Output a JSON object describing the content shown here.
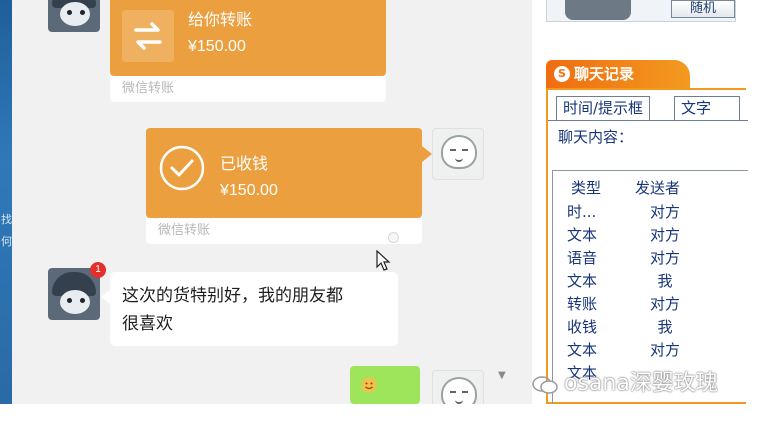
{
  "left_strip": {
    "glyphs": [
      "找",
      "何"
    ]
  },
  "chat": {
    "messages": [
      {
        "type": "transfer",
        "title": "给你转账",
        "amount": "¥150.00",
        "footer": "微信转账"
      },
      {
        "type": "received",
        "title": "已收钱",
        "amount": "¥150.00",
        "footer": "微信转账"
      },
      {
        "type": "text",
        "text_line1": "这次的货特别好，我的朋友都",
        "text_line2": "很喜欢"
      }
    ],
    "unread_badge": "1"
  },
  "right_panel": {
    "random_button": "随机",
    "history_title": "聊天记录",
    "tabs": [
      "时间/提示框",
      "文字"
    ],
    "content_label": "聊天内容：",
    "columns": [
      "类型",
      "发送者"
    ],
    "rows": [
      {
        "type": "时...",
        "sender": "对方"
      },
      {
        "type": "文本",
        "sender": "对方"
      },
      {
        "type": "语音",
        "sender": "对方"
      },
      {
        "type": "文本",
        "sender": "我"
      },
      {
        "type": "转账",
        "sender": "对方"
      },
      {
        "type": "收钱",
        "sender": "我"
      },
      {
        "type": "文本",
        "sender": "对方"
      },
      {
        "type": "文本",
        "sender": ""
      }
    ]
  },
  "watermark": {
    "text": "osana深婴玫瑰"
  },
  "colors": {
    "transfer_orange": "#ec9f3e",
    "history_orange": "#f29a1f",
    "list_text_blue": "#17357a",
    "bubble_green": "#9fe55b"
  }
}
